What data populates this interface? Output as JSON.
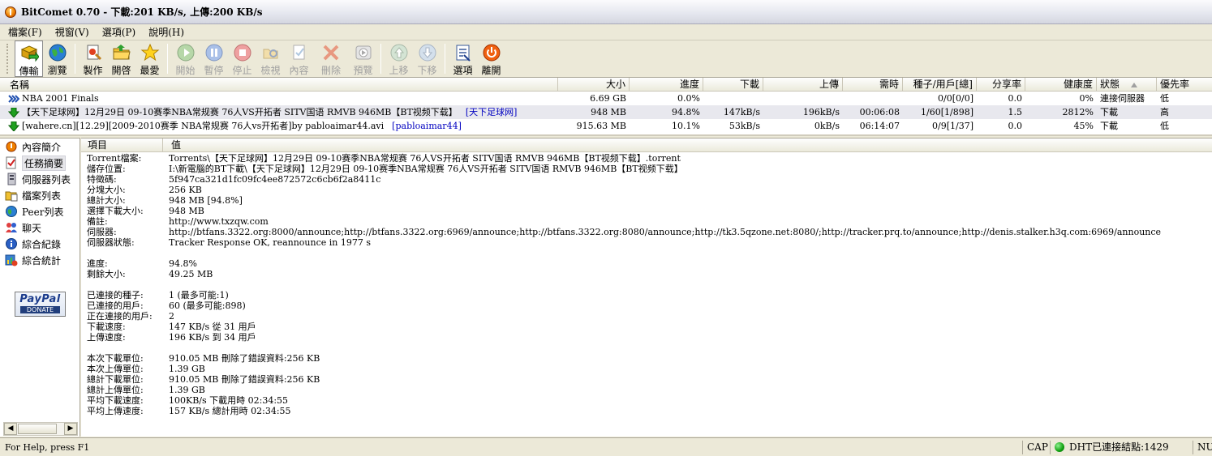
{
  "window": {
    "title": "BitComet 0.70 - 下載:201 KB/s, 上傳:200 KB/s"
  },
  "menu": [
    "檔案(F)",
    "視窗(V)",
    "選項(P)",
    "說明(H)"
  ],
  "toolbar": {
    "transfer": "傳輸",
    "browse": "瀏覽",
    "create": "製作",
    "open": "開啓",
    "favorite": "最愛",
    "start": "開始",
    "pause": "暫停",
    "stop": "停止",
    "check": "檢視",
    "content": "內容",
    "delete": "刪除",
    "preview": "預覽",
    "move_up": "上移",
    "move_down": "下移",
    "options": "選項",
    "exit": "離開"
  },
  "task_list": {
    "columns": [
      "名稱",
      "大小",
      "進度",
      "下載",
      "上傳",
      "需時",
      "種子/用戶[總]",
      "分享率",
      "健康度",
      "狀態",
      "優先率"
    ],
    "rows": [
      {
        "name": "NBA 2001 Finals",
        "tag": "",
        "size": "6.69 GB",
        "progress": "0.0%",
        "down": "",
        "up": "",
        "eta": "",
        "seeds": "0/0[0/0]",
        "ratio": "0.0",
        "health": "0%",
        "state": "連接伺服器",
        "priority": "低"
      },
      {
        "name": "【天下足球网】12月29日 09-10赛季NBA常规赛 76人VS开拓者 SITV国语 RMVB 946MB【BT视频下载】",
        "tag": "[天下足球网]",
        "size": "948 MB",
        "progress": "94.8%",
        "down": "147kB/s",
        "up": "196kB/s",
        "eta": "00:06:08",
        "seeds": "1/60[1/898]",
        "ratio": "1.5",
        "health": "2812%",
        "state": "下載",
        "priority": "高"
      },
      {
        "name": "[wahere.cn][12.29][2009-2010赛季 NBA常规赛 76人vs开拓者]by pabloaimar44.avi",
        "tag": "[pabloaimar44]",
        "size": "915.63 MB",
        "progress": "10.1%",
        "down": "53kB/s",
        "up": "0kB/s",
        "eta": "06:14:07",
        "seeds": "0/9[1/37]",
        "ratio": "0.0",
        "health": "45%",
        "state": "下載",
        "priority": "低"
      }
    ]
  },
  "sidebar": {
    "items": [
      "內容簡介",
      "任務摘要",
      "伺服器列表",
      "檔案列表",
      "Peer列表",
      "聊天",
      "綜合紀錄",
      "綜合統計"
    ],
    "paypal": "PayPal",
    "donate": "DONATE"
  },
  "detail": {
    "columns": [
      "項目",
      "值"
    ],
    "rows": [
      {
        "k": "Torrent檔案:",
        "v": "Torrents\\【天下足球网】12月29日 09-10赛季NBA常规赛 76人VS开拓者 SITV国语 RMVB 946MB【BT视频下载】.torrent"
      },
      {
        "k": "儲存位置:",
        "v": "I:\\新電腦的BT下載\\【天下足球网】12月29日 09-10赛季NBA常规赛 76人VS开拓者 SITV国语 RMVB 946MB【BT视频下载】"
      },
      {
        "k": "特徵碼:",
        "v": "5f947ca321d1fc09fc4ee872572c6cb6f2a8411c"
      },
      {
        "k": "分塊大小:",
        "v": "256 KB"
      },
      {
        "k": "總計大小:",
        "v": "948 MB [94.8%]"
      },
      {
        "k": "選擇下載大小:",
        "v": "948 MB"
      },
      {
        "k": "備註:",
        "v": "http://www.txzqw.com"
      },
      {
        "k": "伺服器:",
        "v": "http://btfans.3322.org:8000/announce;http://btfans.3322.org:6969/announce;http://btfans.3322.org:8080/announce;http://tk3.5qzone.net:8080/;http://tracker.prq.to/announce;http://denis.stalker.h3q.com:6969/announce"
      },
      {
        "k": "伺服器狀態:",
        "v": "Tracker Response OK, reannounce in 1977 s"
      },
      {
        "k": "",
        "v": ""
      },
      {
        "k": "進度:",
        "v": "94.8%"
      },
      {
        "k": "剩餘大小:",
        "v": "49.25 MB"
      },
      {
        "k": "",
        "v": ""
      },
      {
        "k": "已連接的種子:",
        "v": "1 (最多可能:1)"
      },
      {
        "k": "已連接的用戶:",
        "v": "60 (最多可能:898)"
      },
      {
        "k": "正在連接的用戶:",
        "v": "2"
      },
      {
        "k": "下載速度:",
        "v": "147 KB/s 從 31 用戶"
      },
      {
        "k": "上傳速度:",
        "v": "196 KB/s 到 34 用戶"
      },
      {
        "k": "",
        "v": ""
      },
      {
        "k": "本次下載單位:",
        "v": "910.05 MB 刪除了錯誤資料:256 KB"
      },
      {
        "k": "本次上傳單位:",
        "v": "1.39 GB"
      },
      {
        "k": "總計下載單位:",
        "v": "910.05 MB 刪除了錯誤資料:256 KB"
      },
      {
        "k": "總計上傳單位:",
        "v": "1.39 GB"
      },
      {
        "k": "平均下載速度:",
        "v": "100KB/s 下載用時 02:34:55"
      },
      {
        "k": "平均上傳速度:",
        "v": "157 KB/s 總計用時 02:34:55"
      }
    ]
  },
  "status": {
    "help": "For Help, press F1",
    "cap": "CAP",
    "dht": "DHT已連接結點:1429",
    "num": "NUM"
  },
  "colors": {
    "link": "#0000c0",
    "accent_green": "#10a010"
  }
}
